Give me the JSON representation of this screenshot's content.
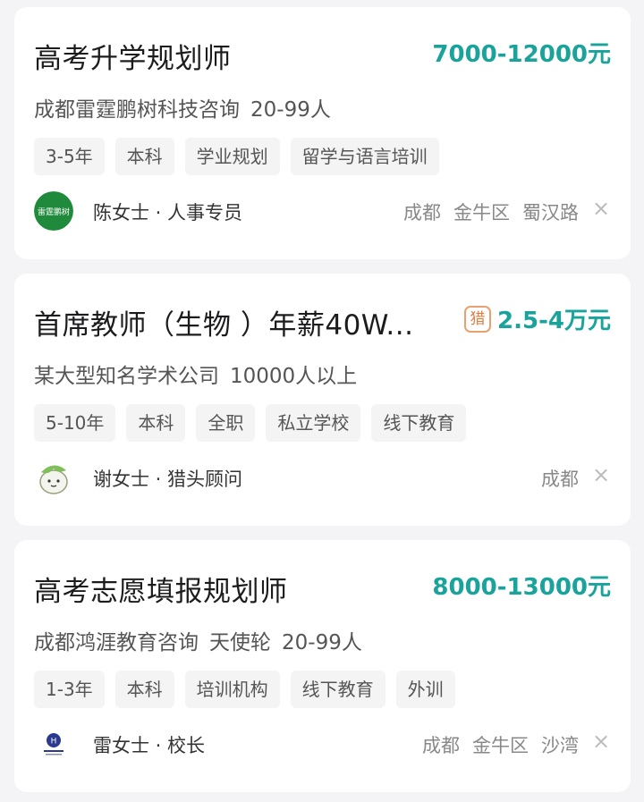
{
  "jobs": [
    {
      "title": "高考升学规划师",
      "salary": "7000-12000元",
      "company": [
        "成都雷霆鹏树科技咨询",
        "20-99人"
      ],
      "tags": [
        "3-5年",
        "本科",
        "学业规划",
        "留学与语言培训"
      ],
      "recruiter": "陈女士 · 人事专员",
      "location": [
        "成都",
        "金牛区",
        "蜀汉路"
      ],
      "avatar_text": "雷霆鹏树",
      "avatar_color": "#1f8a3c"
    },
    {
      "title": "首席教师（生物 ）年薪40W...",
      "hunter_badge": "猎",
      "salary": "2.5-4万元",
      "company": [
        "某大型知名学术公司",
        "10000人以上"
      ],
      "tags": [
        "5-10年",
        "本科",
        "全职",
        "私立学校",
        "线下教育"
      ],
      "recruiter": "谢女士 · 猎头顾问",
      "location": [
        "成都"
      ]
    },
    {
      "title": "高考志愿填报规划师",
      "salary": "8000-13000元",
      "company": [
        "成都鸿涯教育咨询",
        "天使轮",
        "20-99人"
      ],
      "tags": [
        "1-3年",
        "本科",
        "培训机构",
        "线下教育",
        "外训"
      ],
      "recruiter": "雷女士 · 校长",
      "location": [
        "成都",
        "金牛区",
        "沙湾"
      ]
    }
  ],
  "close_symbol": "×",
  "colors": {
    "salary": "#1aa39a",
    "badge": "#e07c40",
    "background": "#f4f4f6"
  }
}
